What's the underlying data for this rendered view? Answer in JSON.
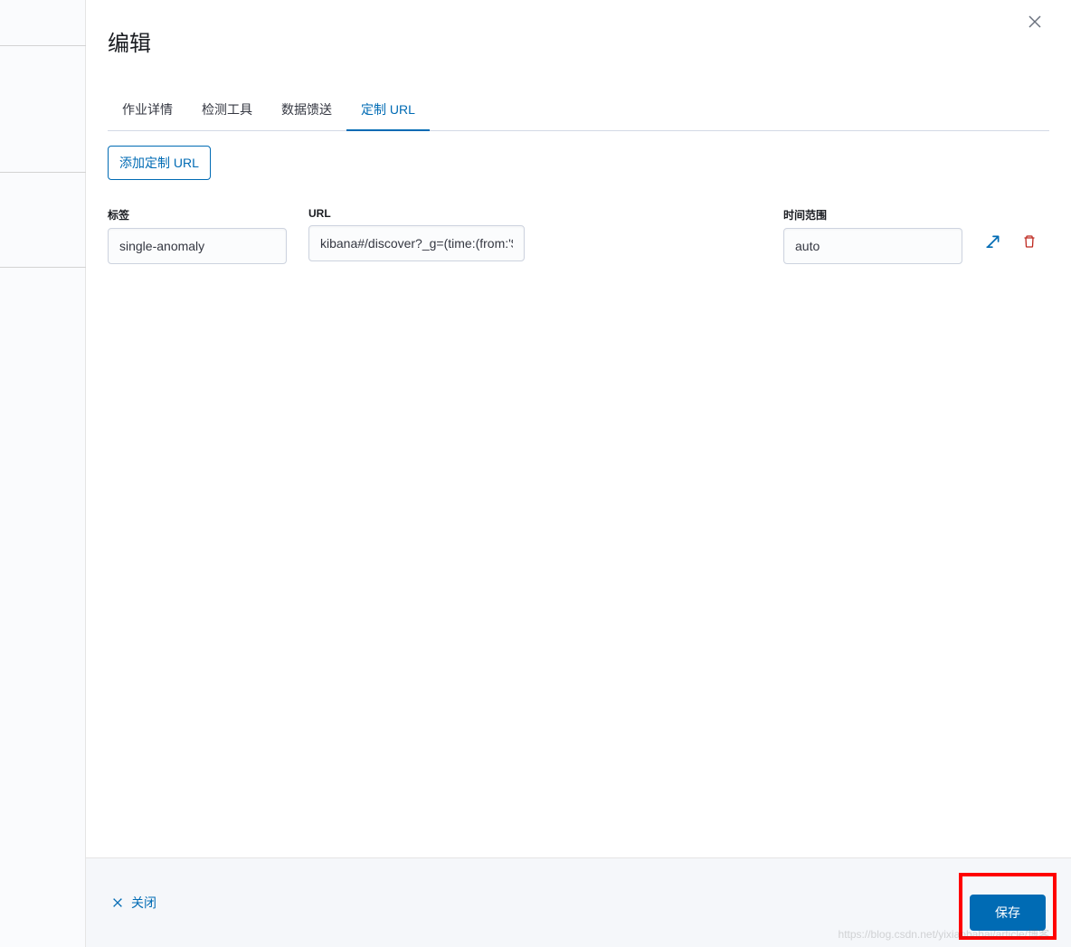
{
  "modal": {
    "title": "编辑"
  },
  "tabs": [
    {
      "label": "作业详情",
      "active": false
    },
    {
      "label": "检测工具",
      "active": false
    },
    {
      "label": "数据馈送",
      "active": false
    },
    {
      "label": "定制 URL",
      "active": true
    }
  ],
  "content": {
    "add_button": "添加定制 URL",
    "columns": {
      "label": "标签",
      "url": "URL",
      "time_range": "时间范围"
    },
    "row": {
      "label_value": "single-anomaly",
      "url_value": "kibana#/discover?_g=(time:(from:'$earliest$',mode:absolu",
      "time_value": "auto"
    }
  },
  "footer": {
    "close": "关闭",
    "save": "保存"
  },
  "watermark": "https://blog.csdn.net/yixiaobahai/article/博客"
}
